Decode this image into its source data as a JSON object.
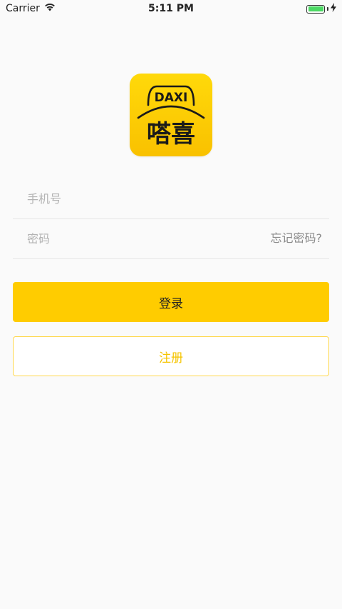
{
  "status_bar": {
    "carrier": "Carrier",
    "time": "5:11 PM",
    "battery_fill": 1.0
  },
  "logo": {
    "text_top": "DAXI",
    "text_bottom": "嗒喜",
    "bg_color": "#ffd200"
  },
  "form": {
    "phone_placeholder": "手机号",
    "password_placeholder": "密码",
    "forgot_label": "忘记密码?"
  },
  "buttons": {
    "login_label": "登录",
    "register_label": "注册"
  },
  "colors": {
    "accent": "#ffcc00",
    "register_text": "#f5c400"
  }
}
